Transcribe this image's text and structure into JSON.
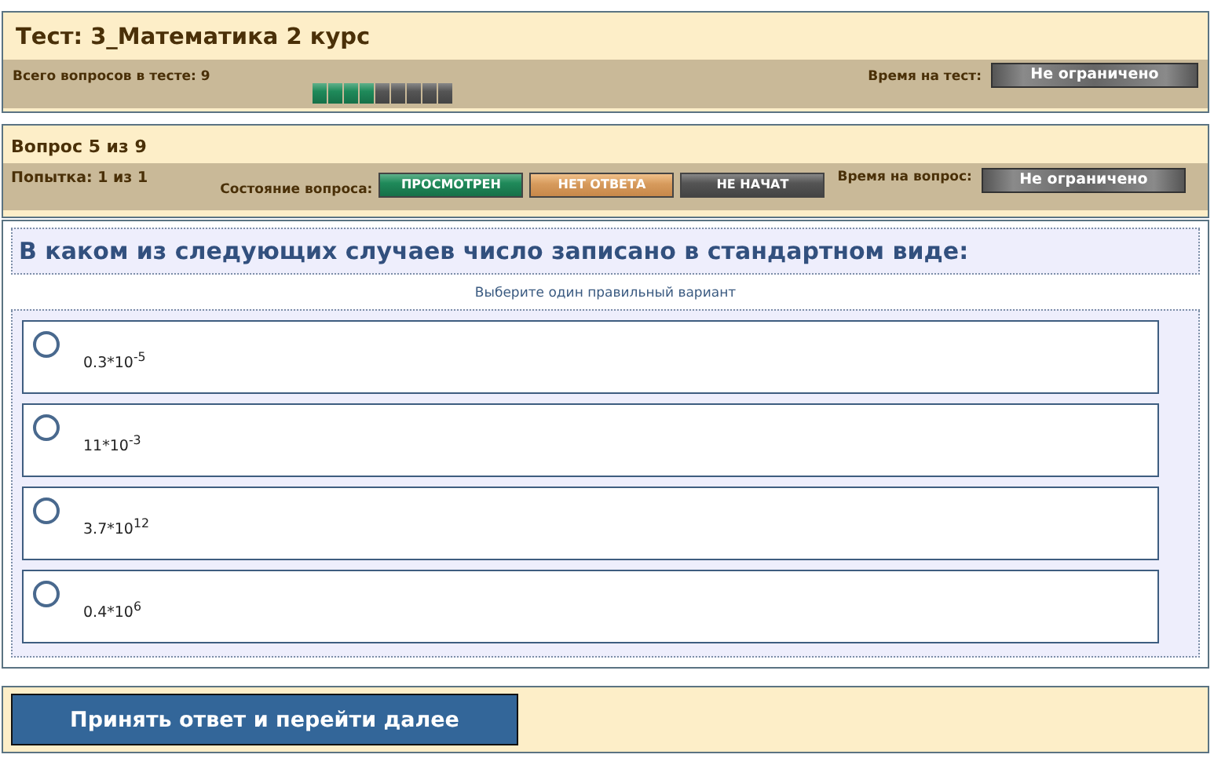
{
  "test": {
    "title": "Тест: 3_Математика 2 курс",
    "total_label": "Всего вопросов в тесте: 9",
    "time_label": "Время на тест:",
    "time_value": "Не ограничено",
    "progress": [
      {
        "kind": "viewed"
      },
      {
        "kind": "viewed"
      },
      {
        "kind": "viewed"
      },
      {
        "kind": "viewed"
      },
      {
        "kind": "unstarted"
      },
      {
        "kind": "unstarted"
      },
      {
        "kind": "unstarted"
      },
      {
        "kind": "unstarted"
      },
      {
        "kind": "unstarted"
      }
    ]
  },
  "question_info": {
    "title": "Вопрос 5 из 9",
    "attempt": "Попытка: 1 из 1",
    "status_label": "Состояние вопроса:",
    "statuses": [
      {
        "label": "ПРОСМОТРЕН",
        "kind": "viewed"
      },
      {
        "label": "НЕТ ОТВЕТА",
        "kind": "unanswered"
      },
      {
        "label": "НЕ НАЧАТ",
        "kind": "unstarted"
      }
    ],
    "time_label": "Время на вопрос:",
    "time_value": "Не ограничено"
  },
  "question": {
    "text": "В каком из следующих случаев число записано в стандартном виде:",
    "hint": "Выберите один правильный вариант",
    "options": [
      {
        "text": "0.3*10$^{-5}$",
        "selected": false
      },
      {
        "text": "11*10$^{-3}$",
        "selected": false
      },
      {
        "text": "3.7*10$^{12}$",
        "selected": false
      },
      {
        "text": "0.4*10$^{6}$",
        "selected": false
      }
    ]
  },
  "submit_button": "Принять ответ и перейти далее"
}
